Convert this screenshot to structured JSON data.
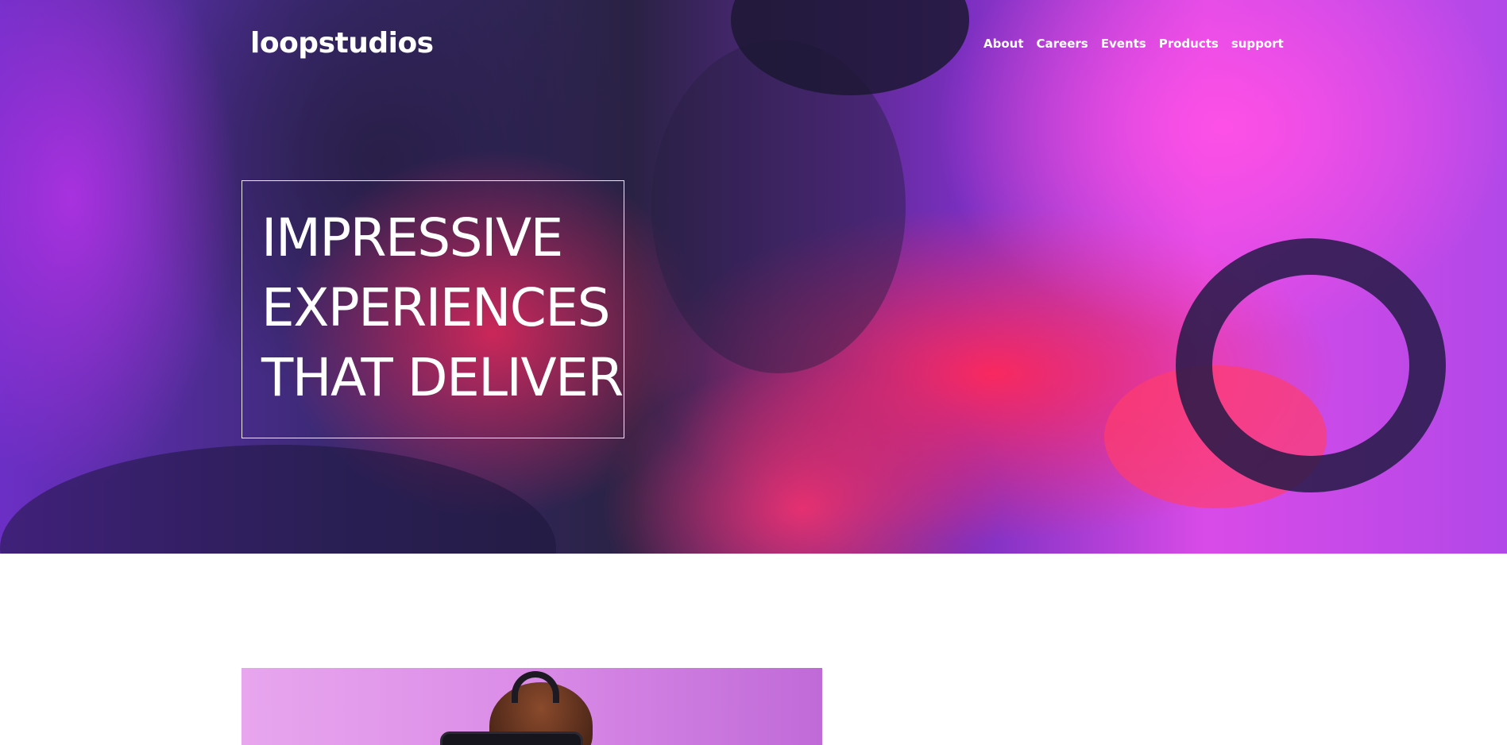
{
  "brand": {
    "logo": "loopstudios"
  },
  "nav": {
    "links": [
      {
        "label": "About"
      },
      {
        "label": "Careers"
      },
      {
        "label": "Events"
      },
      {
        "label": "Products"
      },
      {
        "label": "support"
      }
    ]
  },
  "hero": {
    "headline_lines": [
      "IMPRESSIVE",
      "EXPERIENCES",
      "THAT DELIVER"
    ],
    "background_icon": "vr-gaming-photo"
  },
  "section": {
    "image_icon": "person-wearing-vr-headset-photo"
  },
  "colors": {
    "text_on_hero": "#ffffff",
    "page_background": "#ffffff",
    "hero_accent_pink": "#ff4fe6",
    "hero_accent_red": "#ff2f62",
    "hero_accent_purple": "#7a2fc0"
  }
}
